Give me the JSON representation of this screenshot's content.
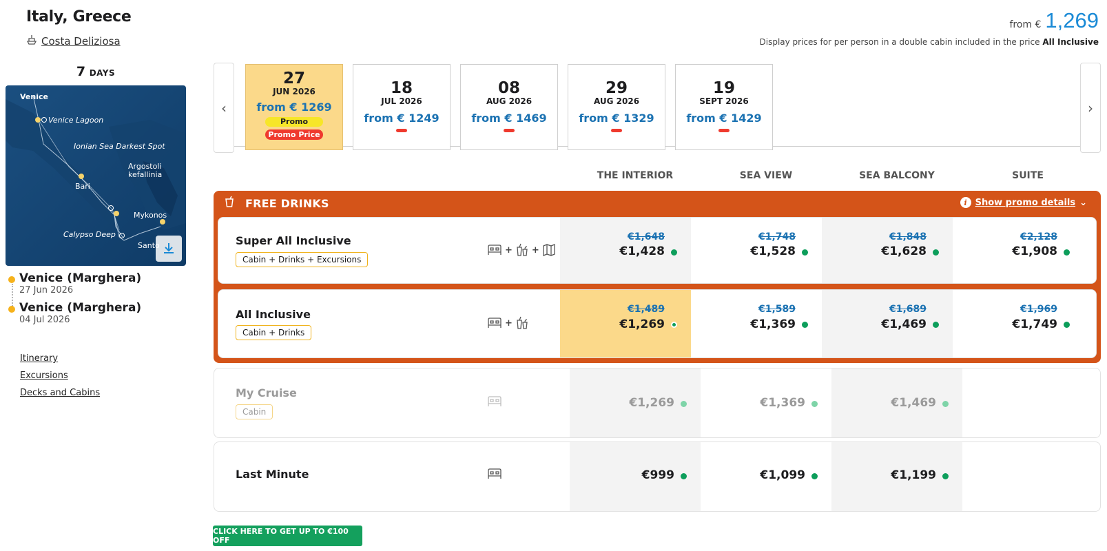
{
  "header": {
    "title": "Italy, Greece",
    "ship_name": "Costa Deliziosa",
    "from_label": "from €",
    "from_price": "1,269",
    "disclaimer_prefix": "Display prices for per person in a double cabin included in the price",
    "disclaimer_bold": "All Inclusive"
  },
  "sidebar": {
    "days_number": "7",
    "days_label": "DAYS",
    "map_labels": {
      "venice": "Venice",
      "lagoon": "Venice Lagoon",
      "ionian": "Ionian Sea Darkest Spot",
      "argostoli": "Argostoli kefallinia",
      "bari": "Bari",
      "mykonos": "Mykonos",
      "calypso": "Calypso Deep",
      "santorini": "Santo"
    },
    "stops": [
      {
        "place": "Venice (Marghera)",
        "date": "27 Jun 2026"
      },
      {
        "place": "Venice (Marghera)",
        "date": "04 Jul 2026"
      }
    ],
    "links": [
      "Itinerary",
      "Excursions",
      "Decks and Cabins"
    ]
  },
  "dates": [
    {
      "day": "27",
      "month": "JUN 2026",
      "price": "from € 1269",
      "promo": "Promo",
      "promo_price": "Promo Price"
    },
    {
      "day": "18",
      "month": "JUL 2026",
      "price": "from € 1249"
    },
    {
      "day": "08",
      "month": "AUG 2026",
      "price": "from € 1469"
    },
    {
      "day": "29",
      "month": "AUG 2026",
      "price": "from € 1329"
    },
    {
      "day": "19",
      "month": "SEPT 2026",
      "price": "from € 1429"
    }
  ],
  "columns": [
    "THE INTERIOR",
    "SEA VIEW",
    "SEA BALCONY",
    "SUITE"
  ],
  "promo": {
    "title": "FREE DRINKS",
    "details_link": "Show promo details",
    "info_glyph": "i",
    "chevron": "⌄"
  },
  "nav": {
    "prev": "‹",
    "next": "›"
  },
  "rows": [
    {
      "name": "Super All Inclusive",
      "tag": "Cabin + Drinks + Excursions",
      "icons_sep": "+",
      "old": [
        "€1,648",
        "€1,748",
        "€1,848",
        "€2,128"
      ],
      "new": [
        "€1,428",
        "€1,528",
        "€1,628",
        "€1,908"
      ]
    },
    {
      "name": "All Inclusive",
      "tag": "Cabin + Drinks",
      "icons_sep": "+",
      "old": [
        "€1,489",
        "€1,589",
        "€1,689",
        "€1,969"
      ],
      "new": [
        "€1,269",
        "€1,369",
        "€1,469",
        "€1,749"
      ]
    },
    {
      "name": "My Cruise",
      "tag": "Cabin",
      "new": [
        "€1,269",
        "€1,369",
        "€1,469"
      ]
    },
    {
      "name": "Last Minute",
      "new": [
        "€999",
        "€1,099",
        "€1,199"
      ]
    }
  ],
  "cta": "CLICK HERE TO GET UP TO €100 OFF",
  "colors": {
    "accent": "#d45419",
    "blue": "#1a8ad6",
    "highlight": "#fbd98a",
    "green": "#0d9e5b",
    "cta": "#14a05d"
  }
}
